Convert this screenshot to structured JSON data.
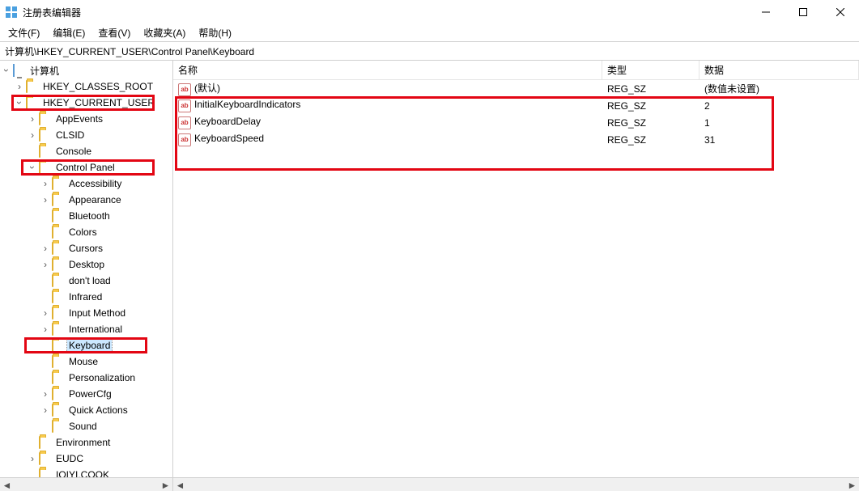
{
  "window": {
    "title": "注册表编辑器"
  },
  "menu": {
    "file": "文件(F)",
    "edit": "编辑(E)",
    "view": "查看(V)",
    "favorites": "收藏夹(A)",
    "help": "帮助(H)"
  },
  "addressbar": {
    "path": "计算机\\HKEY_CURRENT_USER\\Control Panel\\Keyboard"
  },
  "tree": {
    "root": {
      "label": "计算机",
      "expanded": true
    },
    "hkcr": {
      "label": "HKEY_CLASSES_ROOT",
      "expanded": false,
      "hasChildren": true
    },
    "hkcu": {
      "label": "HKEY_CURRENT_USER",
      "expanded": true,
      "hasChildren": true
    },
    "hkcu_children": {
      "appevents": "AppEvents",
      "clsid": "CLSID",
      "console": "Console",
      "controlpanel": "Control Panel",
      "cp_children": {
        "accessibility": "Accessibility",
        "appearance": "Appearance",
        "bluetooth": "Bluetooth",
        "colors": "Colors",
        "cursors": "Cursors",
        "desktop": "Desktop",
        "dontload": "don't load",
        "infrared": "Infrared",
        "inputmethod": "Input Method",
        "international": "International",
        "keyboard": "Keyboard",
        "mouse": "Mouse",
        "personalization": "Personalization",
        "powercfg": "PowerCfg",
        "quickactions": "Quick Actions",
        "sound": "Sound"
      },
      "environment": "Environment",
      "eudc": "EUDC",
      "iqiyi": "IQIYI.COOK"
    }
  },
  "list": {
    "headers": {
      "name": "名称",
      "type": "类型",
      "data": "数据"
    },
    "rows": [
      {
        "name": "(默认)",
        "type": "REG_SZ",
        "data": "(数值未设置)"
      },
      {
        "name": "InitialKeyboardIndicators",
        "type": "REG_SZ",
        "data": "2"
      },
      {
        "name": "KeyboardDelay",
        "type": "REG_SZ",
        "data": "1"
      },
      {
        "name": "KeyboardSpeed",
        "type": "REG_SZ",
        "data": "31"
      }
    ]
  },
  "highlight_color": "#e30613"
}
